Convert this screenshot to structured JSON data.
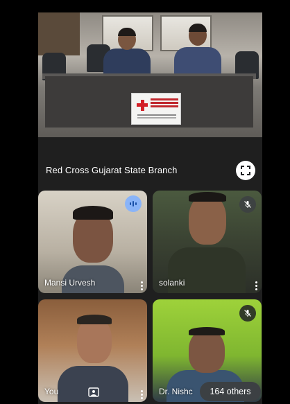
{
  "main_tile": {
    "name": "Red Cross Gujarat State Branch",
    "banner_text": "INDIAN RED CROSS SOCIETY"
  },
  "participants": [
    {
      "name": "Mansi Urvesh",
      "status": "speaking"
    },
    {
      "name": "solanki",
      "status": "muted"
    },
    {
      "name": "You",
      "status": "self"
    },
    {
      "name": "Dr. Nishc",
      "status": "muted"
    }
  ],
  "others": {
    "label": "164 others"
  },
  "colors": {
    "background": "#000000",
    "tile_bg": "#1f1f1f",
    "speaking_accent": "#8ab4f8",
    "red_cross": "#d32027"
  },
  "icons": [
    "fullscreen-icon",
    "speaking-icon",
    "mic-off-icon",
    "more-vert-icon",
    "self-view-frame-icon"
  ]
}
